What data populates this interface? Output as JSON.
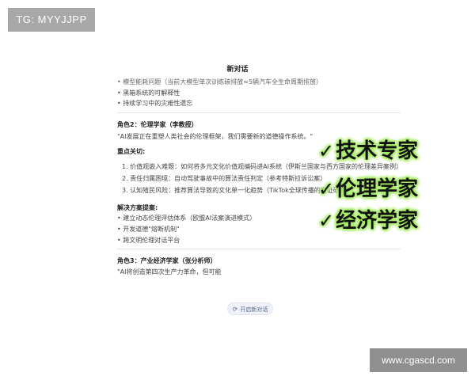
{
  "watermark": "TG: MYYJJPP",
  "site_watermark": "www.cgascd.com",
  "chat": {
    "title": "新对话",
    "intro_lines": [
      "• 模型能耗问题（当前大模型单次训练碳排放≈5辆汽车全生命周期排放）",
      "• 黑箱系统的可解释性",
      "• 持续学习中的灾难性遗忘"
    ],
    "role2": {
      "heading": "角色2：伦理学家（李教授）",
      "quote": "\"AI发展正在重塑人类社会的伦理框架，我们需要新的道德操作系统。\"",
      "key_heading": "重点关切:",
      "key_items": [
        "1. 价值观嵌入难题：如何将多元文化价值观编码进AI系统（伊斯兰国家与西方国家的伦理差异案例）",
        "2. 责任归属困境：自动驾驶事故中的算法责任判定（参考特斯拉诉讼案）",
        "3. 认知殖民风险：推荐算法导致的文化单一化趋势（TikTok全球传播的实证研究）"
      ],
      "solution_heading": "解决方案提案:",
      "solution_items": [
        "• 建立动态伦理评估体系（欧盟AI法案演进模式）",
        "• 开发道德\"熔断机制\"",
        "• 跨文明伦理对话平台"
      ]
    },
    "role3": {
      "heading": "角色3：产业经济学家（张分析师）",
      "quote": "\"AI将创造第四次生产力革命，但可能"
    },
    "new_chat_label": "开启新对话",
    "new_chat_icon": "refresh-icon"
  },
  "overlays": [
    {
      "check": "✓",
      "label": "技术专家"
    },
    {
      "check": "✓",
      "label": "伦理学家"
    },
    {
      "check": "✓",
      "label": "经济学家"
    }
  ]
}
